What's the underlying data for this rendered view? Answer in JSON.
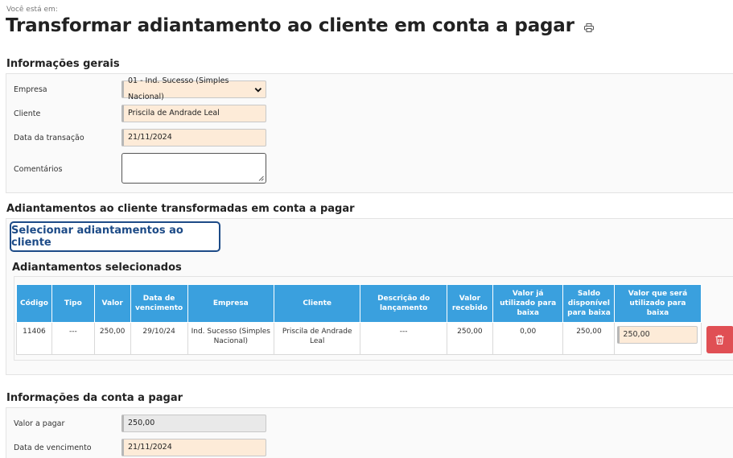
{
  "breadcrumb": "Você está em:",
  "title": "Transformar adiantamento ao cliente em conta a pagar",
  "general": {
    "heading": "Informações gerais",
    "empresa_label": "Empresa",
    "empresa_value": "01 - Ind. Sucesso (Simples Nacional)",
    "cliente_label": "Cliente",
    "cliente_value": "Priscila de Andrade Leal",
    "data_label": "Data da transação",
    "data_value": "21/11/2024",
    "comentarios_label": "Comentários",
    "comentarios_value": ""
  },
  "advances": {
    "heading": "Adiantamentos ao cliente transformadas em conta a pagar",
    "select_button": "Selecionar adiantamentos ao cliente",
    "selected_heading": "Adiantamentos selecionados",
    "columns": [
      "Código",
      "Tipo",
      "Valor",
      "Data de vencimento",
      "Empresa",
      "Cliente",
      "Descrição do lançamento",
      "Valor recebido",
      "Valor já utilizado para baixa",
      "Saldo disponível para baixa",
      "Valor que será utilizado para baixa"
    ],
    "rows": [
      {
        "codigo": "11406",
        "tipo": "---",
        "valor": "250,00",
        "vencimento": "29/10/24",
        "empresa": "Ind. Sucesso (Simples Nacional)",
        "cliente": "Priscila de Andrade Leal",
        "descricao": "---",
        "recebido": "250,00",
        "utilizado": "0,00",
        "saldo": "250,00",
        "a_utilizar": "250,00"
      }
    ]
  },
  "payable": {
    "heading": "Informações da conta a pagar",
    "valor_label": "Valor a pagar",
    "valor_value": "250,00",
    "vencimento_label": "Data de vencimento",
    "vencimento_value": "21/11/2024"
  },
  "colors": {
    "header_blue": "#3aa0de",
    "button_navy": "#1d4b87",
    "input_peach": "#fdebd8",
    "delete_red": "#e04f54"
  },
  "icons": [
    "print-icon",
    "chevron-down-icon",
    "trash-icon",
    "resize-grip-icon"
  ]
}
